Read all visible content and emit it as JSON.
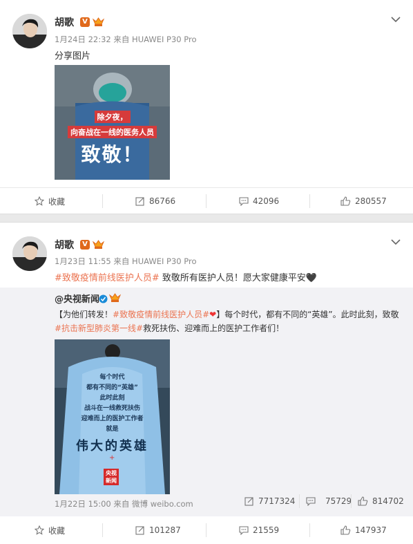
{
  "post1": {
    "author": "胡歌",
    "badge": "V",
    "meta": "1月24日 22:32 来自 HUAWEI P30 Pro",
    "text": "分享图片",
    "image": {
      "line1": "除夕夜，",
      "line2": "向奋战在一线的医务人员",
      "line3": "致敬！"
    },
    "actions": {
      "favorite": "收藏",
      "repost": "86766",
      "comment": "42096",
      "like": "280557"
    }
  },
  "post2": {
    "author": "胡歌",
    "badge": "V",
    "meta": "1月23日 11:55 来自 HUAWEI P30 Pro",
    "text": {
      "tag": "#致敬疫情前线医护人员#",
      "body": " 致敬所有医护人员！愿大家健康平安🖤"
    },
    "repost": {
      "user": "@央视新闻",
      "line1": {
        "prefix": "【为他们转发！",
        "tag": "#致敬疫情前线医护人员#",
        "suffix": "】每个时代，都有不同的“英雄”。此时此刻，致敬"
      },
      "line2": {
        "tag": "#抗击新型肺炎第一线#",
        "suffix": "救死扶伤、迎难而上的医护工作者们！"
      },
      "image": {
        "lines": [
          "每个时代",
          "都有不同的“英雄”",
          "此时此刻",
          "战斗在一线救死扶伤",
          "迎难而上的医护工作者",
          "就是"
        ],
        "headline": "伟大的英雄",
        "logo": "央视新闻"
      },
      "meta": "1月22日 15:00 来自 微博 weibo.com",
      "stats": {
        "repost": "7717324",
        "comment": "75729",
        "like": "814702"
      }
    },
    "actions": {
      "favorite": "收藏",
      "repost": "101287",
      "comment": "21559",
      "like": "147937"
    }
  },
  "colors": {
    "tag": "#eb7350",
    "badge": "#e0691b",
    "verified_blue": "#1a8bd8",
    "separator": "#e9e9e9"
  }
}
